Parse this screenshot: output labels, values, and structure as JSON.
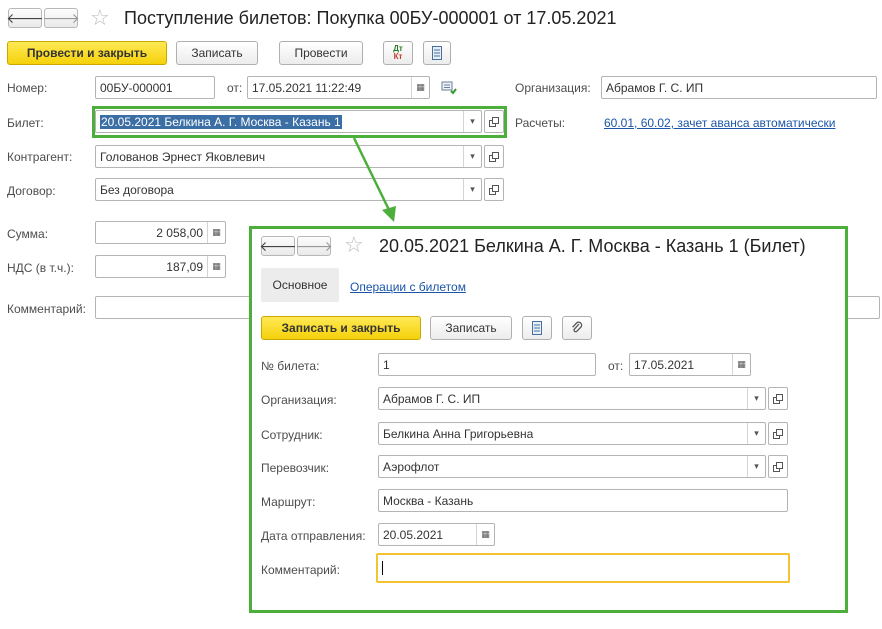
{
  "doc": {
    "title": "Поступление билетов: Покупка 00БУ-000001 от 17.05.2021",
    "toolbar": {
      "post_close": "Провести и закрыть",
      "save": "Записать",
      "post": "Провести",
      "dtkt_top": "Дт",
      "dtkt_bottom": "Кт"
    },
    "number_label": "Номер:",
    "number_value": "00БУ-000001",
    "from_label": "от:",
    "date_value": "17.05.2021 11:22:49",
    "org_label": "Организация:",
    "org_value": "Абрамов Г. С. ИП",
    "ticket_label": "Билет:",
    "ticket_value": "20.05.2021 Белкина А. Г. Москва - Казань 1",
    "settlements_label": "Расчеты:",
    "settlements_link": "60.01, 60.02, зачет аванса автоматически",
    "counterparty_label": "Контрагент:",
    "counterparty_value": "Голованов Эрнест Яковлевич",
    "contract_label": "Договор:",
    "contract_value": "Без договора",
    "sum_label": "Сумма:",
    "sum_value": "2 058,00",
    "vat_label": "НДС (в т.ч.):",
    "vat_value": "187,09",
    "comment_label": "Комментарий:"
  },
  "ticket": {
    "title": "20.05.2021 Белкина А. Г. Москва - Казань 1 (Билет)",
    "tabs": [
      "Основное",
      "Операции с билетом"
    ],
    "toolbar": {
      "save_close": "Записать и закрыть",
      "save": "Записать"
    },
    "number_label": "№ билета:",
    "number_value": "1",
    "from_label": "от:",
    "date_value": "17.05.2021",
    "org_label": "Организация:",
    "org_value": "Абрамов Г. С. ИП",
    "employee_label": "Сотрудник:",
    "employee_value": "Белкина Анна Григорьевна",
    "carrier_label": "Перевозчик:",
    "carrier_value": "Аэрофлот",
    "route_label": "Маршрут:",
    "route_value": "Москва - Казань",
    "departure_label": "Дата отправления:",
    "departure_value": "20.05.2021",
    "comment_label": "Комментарий:"
  },
  "colors": {
    "accent_green": "#4caf3b",
    "primary_yellow": "#f5d10a",
    "link_blue": "#1a55a8",
    "selection": "#3b6ea5"
  }
}
